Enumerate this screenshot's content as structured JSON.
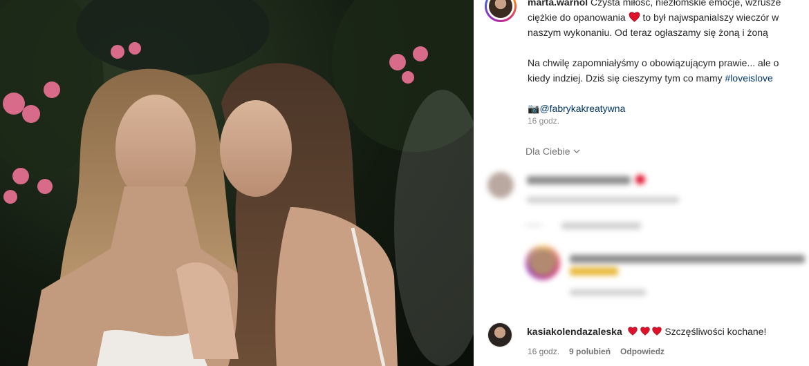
{
  "post": {
    "author": "marta.warnol",
    "caption_line1_rest": "Czysta miłość, niezłomskie emocje, wzrusze",
    "caption_line2_a": "ciężkie do opanowania",
    "caption_line2_b": "to był najwspanialszy wieczór w",
    "caption_line3": "naszym wykonaniu. Od teraz ogłaszamy się żoną i żoną",
    "caption_line4": "Na chwilę zapomniałyśmy o obowiązującym prawie... ale o",
    "caption_line5_a": "kiedy indziej. Dziś się cieszymy tym co mamy",
    "hashtag": "#loveislove",
    "camera_emoji": "📷",
    "mention": "@fabrykakreatywna",
    "time": "16 godz."
  },
  "filter": {
    "label": "Dla Ciebie",
    "icon": "chevron-down-icon"
  },
  "comments": [
    {
      "username": "kasiakolendazaleska",
      "text": "Szczęśliwości kochane!",
      "hearts": 3,
      "time": "16 godz.",
      "likes": "9 polubień",
      "reply": "Odpowiedz"
    }
  ],
  "colors": {
    "heart": "#e0112b",
    "link": "#00376b",
    "muted": "#737373"
  }
}
